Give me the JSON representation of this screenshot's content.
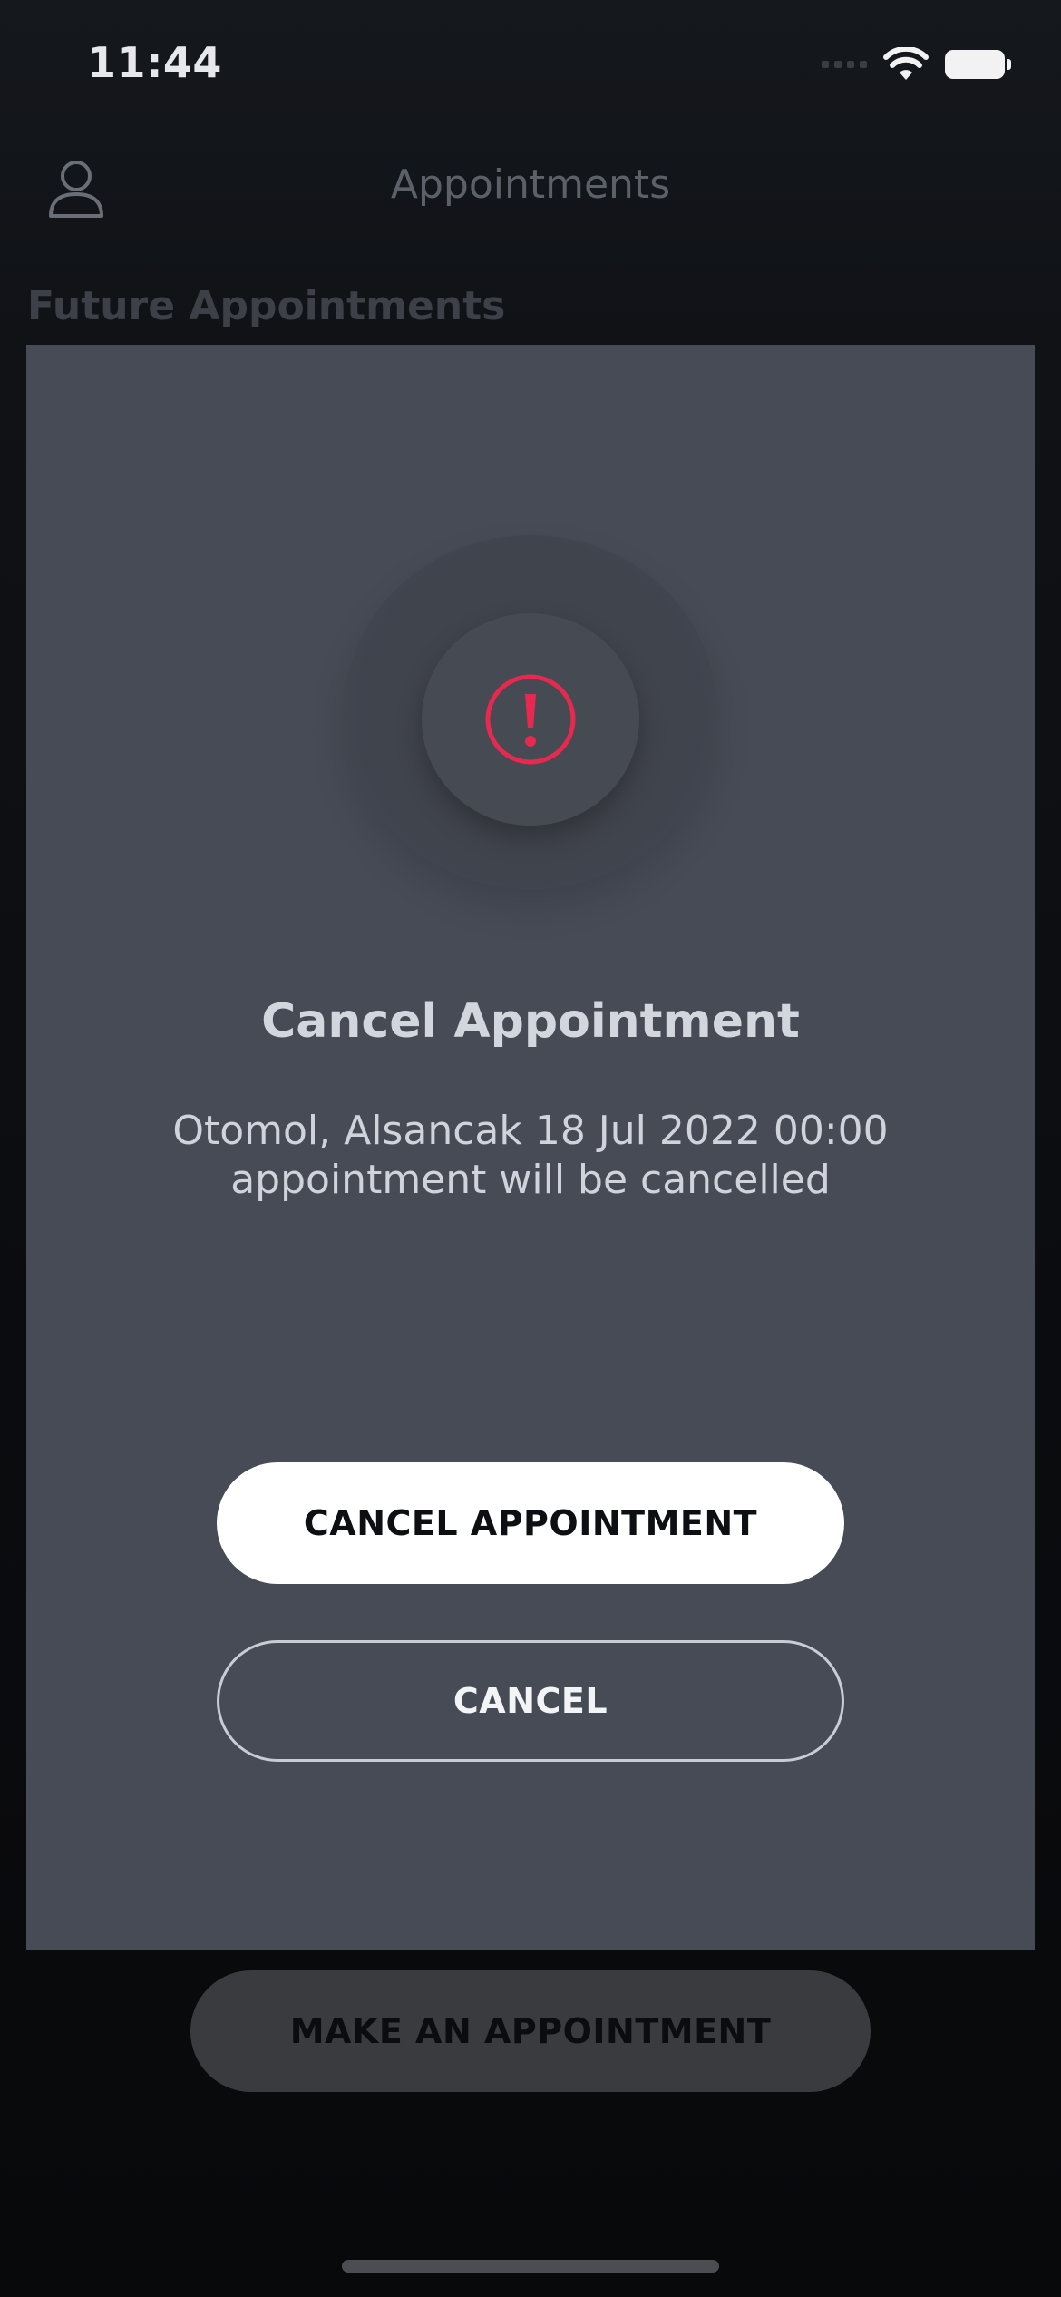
{
  "status_bar": {
    "time": "11:44",
    "icons": [
      "signal-icon",
      "wifi-icon",
      "battery-icon"
    ]
  },
  "header": {
    "title": "Appointments",
    "profile_icon": "person-icon"
  },
  "section": {
    "title": "Future Appointments"
  },
  "modal": {
    "icon": "alert-circle-icon",
    "title": "Cancel Appointment",
    "message_line1": "Otomol, Alsancak 18 Jul 2022 00:00",
    "message_line2": "appointment will be cancelled",
    "confirm_label": "CANCEL APPOINTMENT",
    "dismiss_label": "CANCEL",
    "accent_color": "#e8294f"
  },
  "footer": {
    "make_appointment_label": "MAKE AN APPOINTMENT"
  }
}
